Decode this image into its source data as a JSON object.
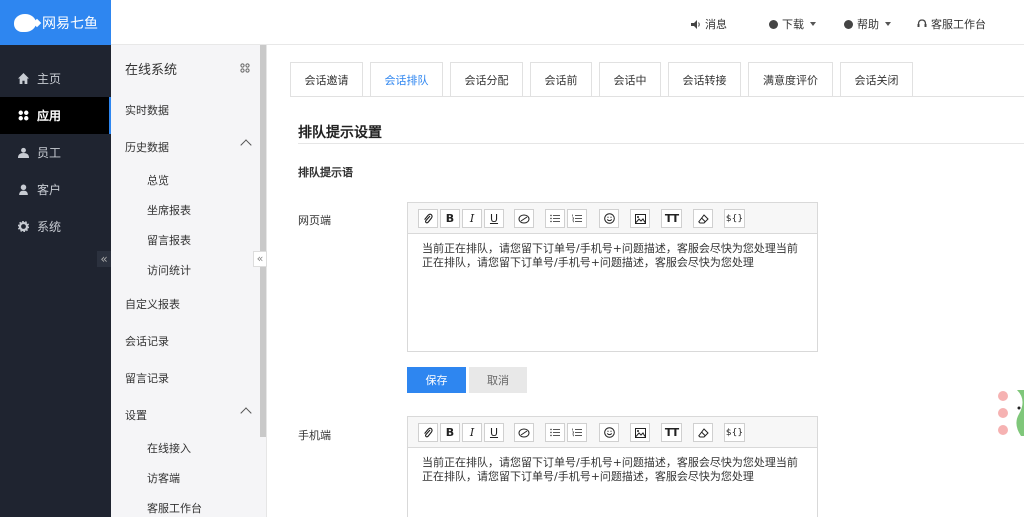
{
  "brand": {
    "name": "网易七鱼"
  },
  "left_nav": {
    "items": [
      {
        "label": "主页",
        "icon": "home-icon"
      },
      {
        "label": "应用",
        "icon": "apps-icon",
        "active": true
      },
      {
        "label": "员工",
        "icon": "staff-icon"
      },
      {
        "label": "客户",
        "icon": "customer-icon"
      },
      {
        "label": "系统",
        "icon": "gear-icon"
      }
    ],
    "collapse_glyph": "«"
  },
  "topbar": {
    "message": "消息",
    "download": "下载",
    "help": "帮助",
    "workbench": "客服工作台"
  },
  "sub_nav": {
    "title": "在线系统",
    "collapse_glyph": "«",
    "realtime": "实时数据",
    "history": "历史数据",
    "history_children": [
      "总览",
      "坐席报表",
      "留言报表",
      "访问统计"
    ],
    "custom_report": "自定义报表",
    "session_records": "会话记录",
    "message_records": "留言记录",
    "settings": "设置",
    "settings_children": [
      "在线接入",
      "访客端",
      "客服工作台"
    ]
  },
  "tabs": [
    "会话邀请",
    "会话排队",
    "会话分配",
    "会话前",
    "会话中",
    "会话转接",
    "满意度评价",
    "会话关闭"
  ],
  "active_tab": "会话排队",
  "section": {
    "title": "排队提示设置",
    "subtitle": "排队提示语",
    "web_label": "网页端",
    "mobile_label": "手机端",
    "web_text": "当前正在排队，请您留下订单号/手机号+问题描述，客服会尽快为您处理当前正在排队，请您留下订单号/手机号+问题描述，客服会尽快为您处理",
    "mobile_text": "当前正在排队，请您留下订单号/手机号+问题描述，客服会尽快为您处理当前正在排队，请您留下订单号/手机号+问题描述，客服会尽快为您处理"
  },
  "toolbar": {
    "bold": "B",
    "italic": "I",
    "underline": "U",
    "font_size": "TT",
    "variable": "${}"
  },
  "buttons": {
    "save": "保存",
    "cancel": "取消"
  },
  "colors": {
    "primary": "#2e86f0",
    "sidebar": "#1f2430"
  }
}
